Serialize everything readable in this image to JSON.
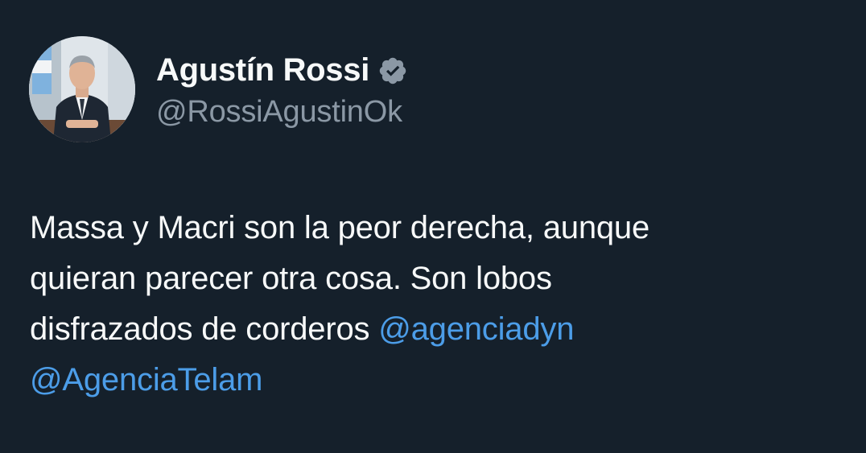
{
  "author": {
    "display_name": "Agustín Rossi",
    "handle": "@RossiAgustinOk",
    "verified": true,
    "verified_icon": "verified-badge-icon",
    "avatar": "profile-photo"
  },
  "tweet": {
    "lines": [
      "Massa y Macri son la peor derecha, aunque",
      "quieran parecer otra cosa. Son lobos",
      "disfrazados de corderos "
    ],
    "mentions": [
      "@agenciadyn",
      "@AgenciaTelam"
    ]
  },
  "colors": {
    "background": "#15202b",
    "text": "#f7f9f9",
    "secondary_text": "#8b98a5",
    "link": "#4c9de8",
    "verified_badge": "#8b98a5"
  }
}
